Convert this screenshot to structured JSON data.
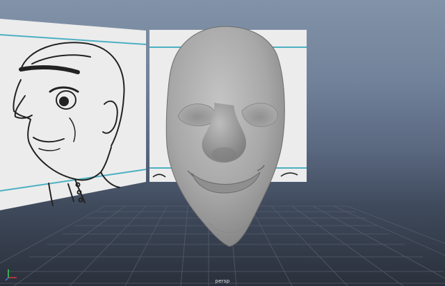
{
  "viewport": {
    "camera_label": "persp",
    "colors": {
      "background_top": "#8293a8",
      "background_bottom": "#2a303b",
      "mesh": "#a9a9a9",
      "mesh_shadow": "#6f6f6f",
      "grid": "#59606c",
      "image_plane": "#ececec",
      "image_plane_guide": "#4bb0c1",
      "axis_x": "#d8383a",
      "axis_y": "#3fd05a",
      "axis_z": "#4a78e8"
    },
    "icons": [
      "axis-gizmo-icon"
    ]
  }
}
